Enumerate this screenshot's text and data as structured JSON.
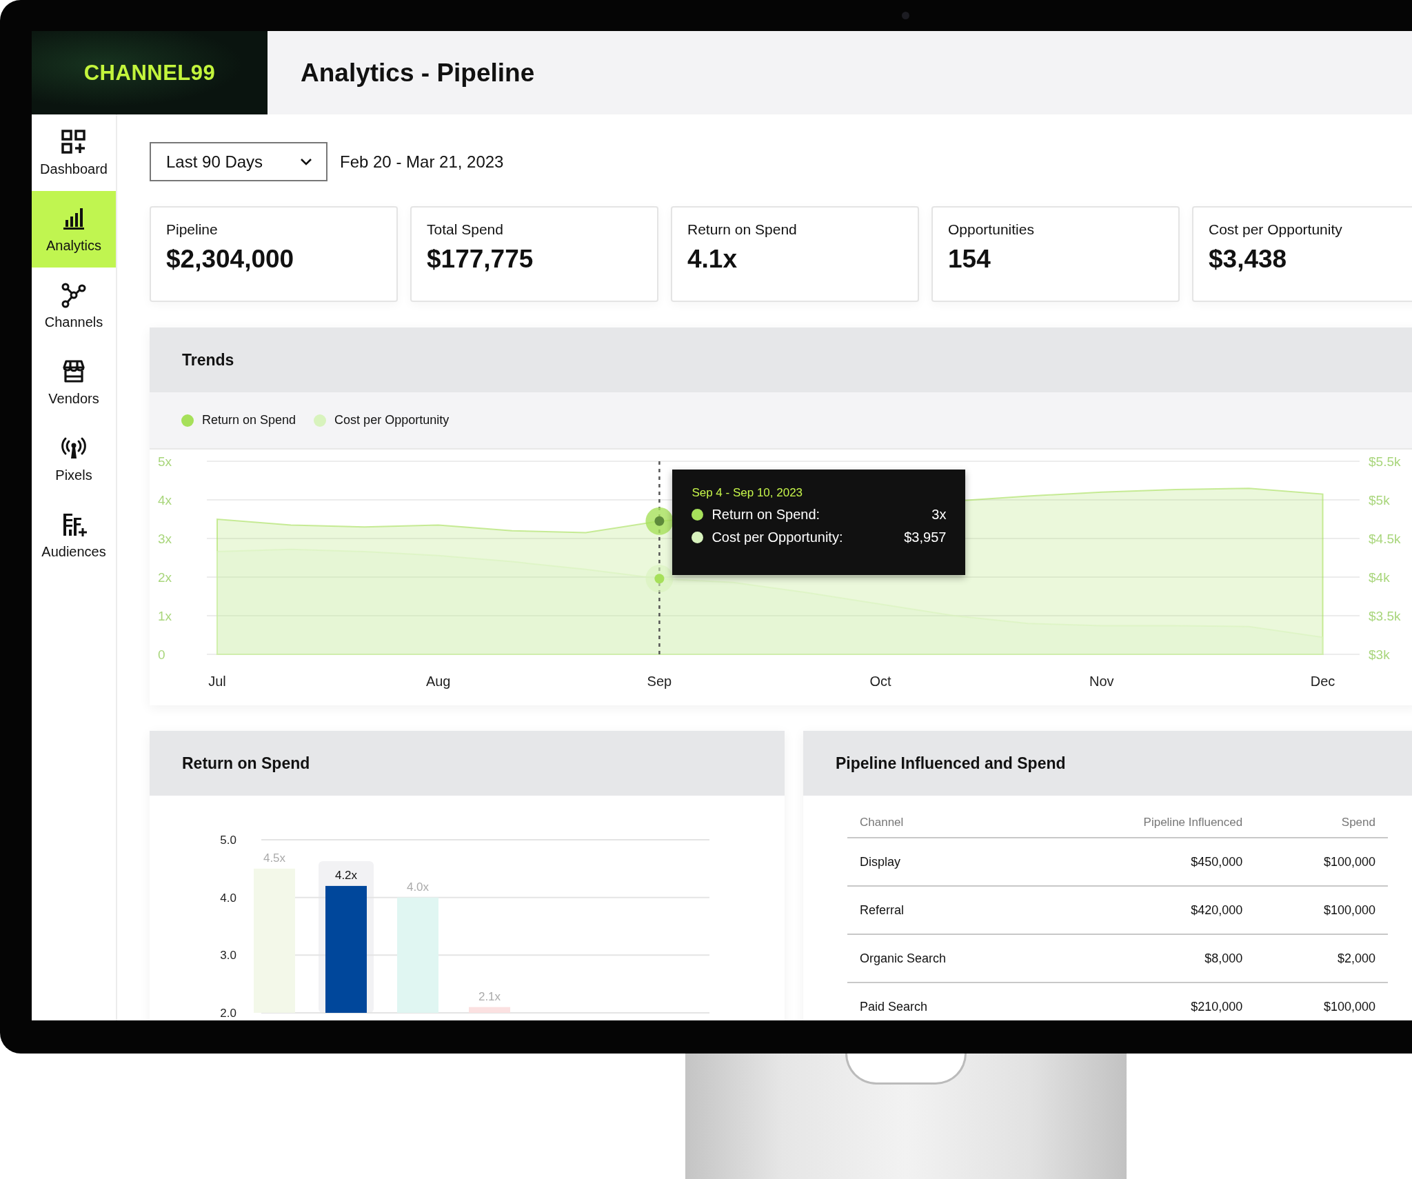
{
  "brand": {
    "logo_text": "CHANNEL99"
  },
  "header": {
    "title": "Analytics - Pipeline"
  },
  "sidebar": {
    "items": [
      {
        "label": "Dashboard",
        "selected": false
      },
      {
        "label": "Analytics",
        "selected": true
      },
      {
        "label": "Channels",
        "selected": false
      },
      {
        "label": "Vendors",
        "selected": false
      },
      {
        "label": "Pixels",
        "selected": false
      },
      {
        "label": "Audiences",
        "selected": false
      }
    ]
  },
  "filters": {
    "range": {
      "value": "Last 90 Days"
    },
    "date_range": "Feb 20 - Mar 21, 2023"
  },
  "kpis": [
    {
      "label": "Pipeline",
      "value": "$2,304,000"
    },
    {
      "label": "Total Spend",
      "value": "$177,775"
    },
    {
      "label": "Return on Spend",
      "value": "4.1x"
    },
    {
      "label": "Opportunities",
      "value": "154"
    },
    {
      "label": "Cost per Opportunity",
      "value": "$3,438"
    }
  ],
  "trends": {
    "title": "Trends",
    "chart_data": {
      "type": "area",
      "categories": [
        "Jul",
        null,
        null,
        "Aug",
        null,
        null,
        "Sep",
        null,
        null,
        "Oct",
        null,
        null,
        "Nov",
        null,
        null,
        "Dec"
      ],
      "ylim": [
        0,
        5
      ],
      "yticks": [
        {
          "value": 0,
          "label": "0"
        },
        {
          "value": 1,
          "label": "1x"
        },
        {
          "value": 2,
          "label": "2x"
        },
        {
          "value": 3,
          "label": "3x"
        },
        {
          "value": 4,
          "label": "4x"
        },
        {
          "value": 5,
          "label": "5x"
        }
      ],
      "y2lim": [
        3,
        5.5
      ],
      "y2ticks": [
        {
          "value": 3,
          "label": "$3k"
        },
        {
          "value": 3.5,
          "label": "$3.5k"
        },
        {
          "value": 4,
          "label": "$4k"
        },
        {
          "value": 4.5,
          "label": "$4.5k"
        },
        {
          "value": 5,
          "label": "$5k"
        },
        {
          "value": 5.5,
          "label": "$5.5k"
        }
      ],
      "series": [
        {
          "name": "Return on Spend",
          "color": "#a6e05a",
          "values": [
            3.5,
            3.35,
            3.3,
            3.35,
            3.2,
            3.15,
            3.45,
            null,
            null,
            null,
            null,
            4.1,
            4.2,
            4.27,
            4.3,
            4.15
          ]
        },
        {
          "name": "Cost per Opportunity",
          "color": "#d8f3bd",
          "axis": "y2",
          "values": [
            4.33,
            4.36,
            4.33,
            4.28,
            4.2,
            4.1,
            3.98,
            3.93,
            3.8,
            3.65,
            3.5,
            3.4,
            3.37,
            3.37,
            3.36,
            3.22
          ]
        }
      ],
      "grid": true,
      "legend": true,
      "annotations": [
        "Sep 4 - Sep 10, 2023"
      ]
    },
    "tooltip_rows": [
      {
        "label": "Return on Spend:",
        "value": "3x"
      },
      {
        "label": "Cost per Opportunity:",
        "value": "$3,957"
      }
    ]
  },
  "return_on_spend": {
    "title": "Return on Spend",
    "chart_data": {
      "type": "bar",
      "ylim": [
        2,
        5
      ],
      "yticks": [
        {
          "value": 2,
          "label": "2.0"
        },
        {
          "value": 3,
          "label": "3.0"
        },
        {
          "value": 4,
          "label": "4.0"
        },
        {
          "value": 5,
          "label": "5.0"
        }
      ],
      "values": [
        4.5,
        4.2,
        4.0,
        2.1
      ],
      "colors": [
        "#f3f8e9",
        "#00479b",
        "#e0f6f2",
        "#fbe1e1"
      ],
      "value_labels": [
        "4.5x",
        "4.2x",
        "4.0x",
        "2.1x"
      ]
    },
    "bars": [
      {
        "selected": false
      },
      {
        "selected": true
      },
      {
        "selected": false
      },
      {
        "selected": false
      }
    ]
  },
  "pipeline_table": {
    "title": "Pipeline Influenced and Spend",
    "columns": [
      "Channel",
      "Pipeline Influenced",
      "Spend"
    ],
    "rows": [
      [
        "Display",
        "$450,000",
        "$100,000"
      ],
      [
        "Referral",
        "$420,000",
        "$100,000"
      ],
      [
        "Organic Search",
        "$8,000",
        "$2,000"
      ],
      [
        "Paid Search",
        "$210,000",
        "$100,000"
      ]
    ]
  }
}
